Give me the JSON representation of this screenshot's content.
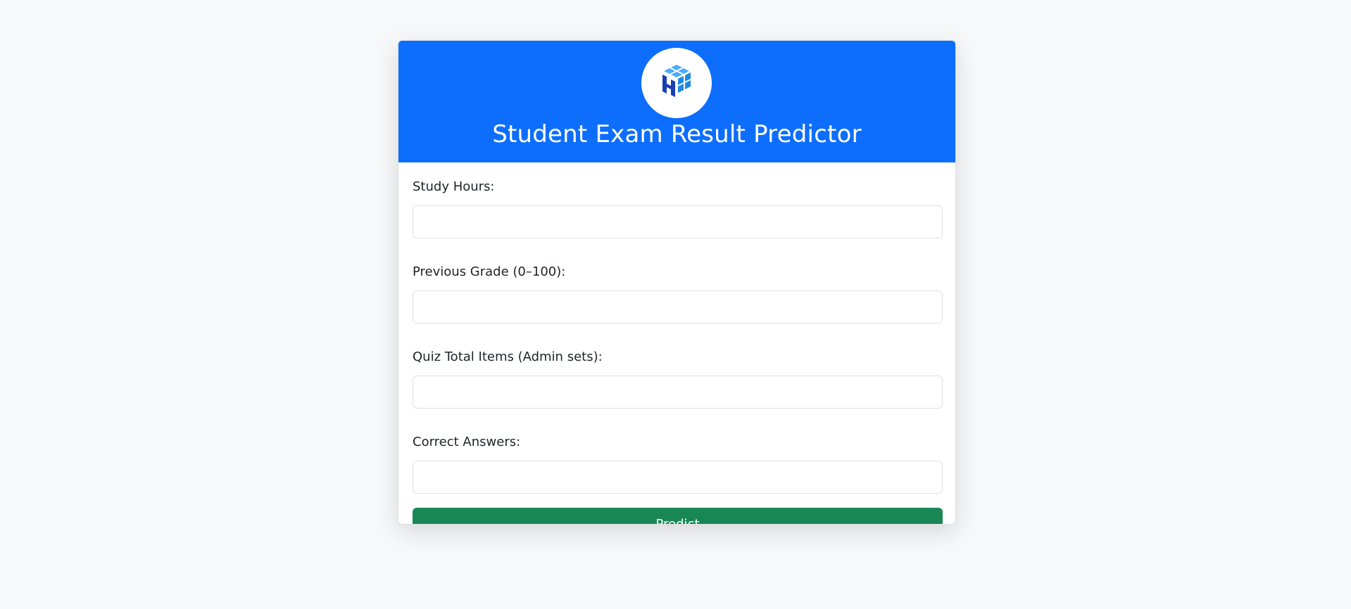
{
  "header": {
    "logo_icon": "numpy-logo-icon",
    "title": "Student Exam Result Predictor"
  },
  "form": {
    "fields": [
      {
        "label": "Study Hours:",
        "value": "",
        "placeholder": ""
      },
      {
        "label": "Previous Grade (0–100):",
        "value": "",
        "placeholder": ""
      },
      {
        "label": "Quiz Total Items (Admin sets):",
        "value": "",
        "placeholder": ""
      },
      {
        "label": "Correct Answers:",
        "value": "",
        "placeholder": ""
      }
    ],
    "submit_label": "Predict"
  },
  "colors": {
    "header_bg": "#0d6efd",
    "button_bg": "#198754",
    "page_bg": "#f6f8fa"
  }
}
